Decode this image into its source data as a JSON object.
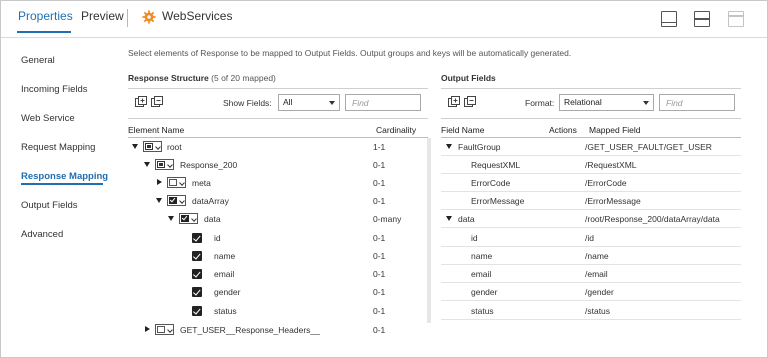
{
  "tabs": [
    {
      "label": "Properties",
      "active": true
    },
    {
      "label": "Preview",
      "active": false
    }
  ],
  "transformation": {
    "name": "WebServices",
    "icon": "gear-icon"
  },
  "layout_buttons": [
    "layout-bottom-panel-icon",
    "layout-split-icon",
    "layout-maximize-icon"
  ],
  "sidebar": {
    "items": [
      {
        "label": "General"
      },
      {
        "label": "Incoming Fields"
      },
      {
        "label": "Web Service"
      },
      {
        "label": "Request Mapping"
      },
      {
        "label": "Response Mapping",
        "active": true
      },
      {
        "label": "Output Fields"
      },
      {
        "label": "Advanced"
      }
    ]
  },
  "instructions": "Select elements of Response to be mapped to Output Fields. Output groups and keys will be automatically generated.",
  "response": {
    "title": "Response Structure",
    "count": "(5 of 20 mapped)",
    "show_fields_label": "Show Fields:",
    "show_fields_value": "All",
    "find_placeholder": "Find",
    "col_element": "Element Name",
    "col_cardinality": "Cardinality",
    "rows": [
      {
        "name": "root",
        "card": "1-1"
      },
      {
        "name": "Response_200",
        "card": "0-1"
      },
      {
        "name": "meta",
        "card": "0-1"
      },
      {
        "name": "dataArray",
        "card": "0-1"
      },
      {
        "name": "data",
        "card": "0-many"
      },
      {
        "name": "id",
        "card": "0-1"
      },
      {
        "name": "name",
        "card": "0-1"
      },
      {
        "name": "email",
        "card": "0-1"
      },
      {
        "name": "gender",
        "card": "0-1"
      },
      {
        "name": "status",
        "card": "0-1"
      },
      {
        "name": "GET_USER__Response_Headers__",
        "card": "0-1"
      }
    ]
  },
  "output": {
    "title": "Output Fields",
    "format_label": "Format:",
    "format_value": "Relational",
    "find_placeholder": "Find",
    "col_field": "Field Name",
    "col_actions": "Actions",
    "col_mapped": "Mapped Field",
    "rows": [
      {
        "name": "FaultGroup",
        "mapped": "/GET_USER_FAULT/GET_USER"
      },
      {
        "name": "RequestXML",
        "mapped": "/RequestXML"
      },
      {
        "name": "ErrorCode",
        "mapped": "/ErrorCode"
      },
      {
        "name": "ErrorMessage",
        "mapped": "/ErrorMessage"
      },
      {
        "name": "data",
        "mapped": "/root/Response_200/dataArray/data"
      },
      {
        "name": "id",
        "mapped": "/id"
      },
      {
        "name": "name",
        "mapped": "/name"
      },
      {
        "name": "email",
        "mapped": "/email"
      },
      {
        "name": "gender",
        "mapped": "/gender"
      },
      {
        "name": "status",
        "mapped": "/status"
      }
    ]
  },
  "colors": {
    "accent": "#1f6fb2",
    "gear": "#f08a24"
  }
}
